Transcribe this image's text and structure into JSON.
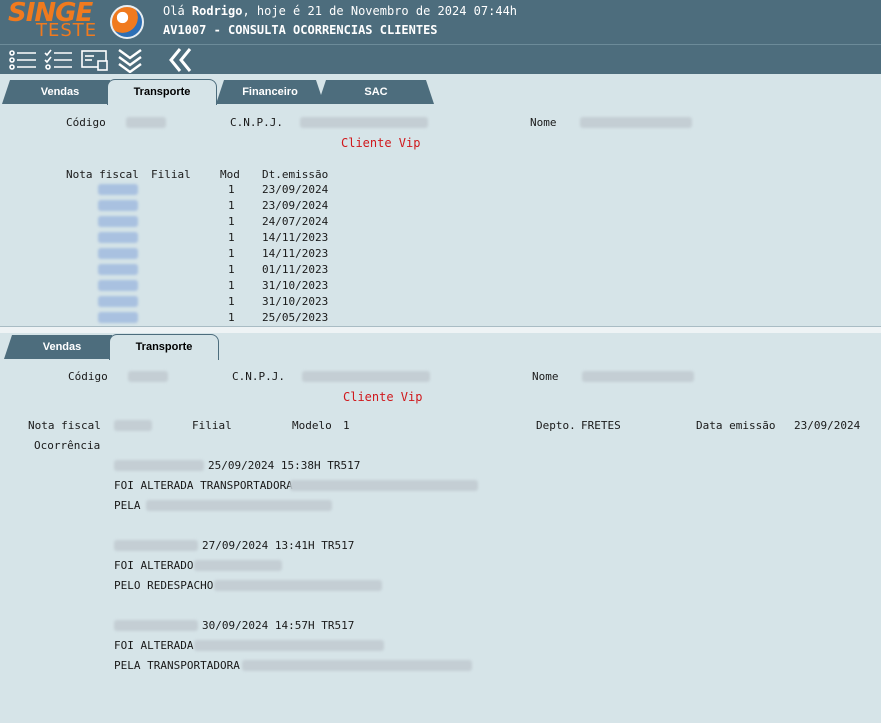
{
  "header": {
    "logo_top": "SINGE",
    "logo_bottom": "TESTE",
    "greeting_prefix": "Olá ",
    "user_name": "Rodrigo",
    "greeting_suffix": ", hoje é 21 de Novembro de 2024 07:44h",
    "screen_title": "AV1007 - CONSULTA OCORRENCIAS CLIENTES"
  },
  "toolbar": {
    "icons": [
      "list-icon",
      "checklist-icon",
      "card-icon",
      "double-chevron-down-icon",
      "double-chevron-left-icon"
    ]
  },
  "top_tabs": [
    "Vendas",
    "Transporte",
    "Financeiro",
    "SAC"
  ],
  "top_panel": {
    "codigo_label": "Código",
    "cnpj_label": "C.N.P.J.",
    "nome_label": "Nome",
    "vip_text": "Cliente Vip",
    "columns": [
      "Nota fiscal",
      "Filial",
      "Mod",
      "Dt.emissão"
    ],
    "rows": [
      {
        "mod": "1",
        "date": "23/09/2024"
      },
      {
        "mod": "1",
        "date": "23/09/2024"
      },
      {
        "mod": "1",
        "date": "24/07/2024"
      },
      {
        "mod": "1",
        "date": "14/11/2023"
      },
      {
        "mod": "1",
        "date": "14/11/2023"
      },
      {
        "mod": "1",
        "date": "01/11/2023"
      },
      {
        "mod": "1",
        "date": "31/10/2023"
      },
      {
        "mod": "1",
        "date": "31/10/2023"
      },
      {
        "mod": "1",
        "date": "25/05/2023"
      }
    ]
  },
  "bottom_tabs": [
    "Vendas",
    "Transporte"
  ],
  "bottom_panel": {
    "codigo_label": "Código",
    "cnpj_label": "C.N.P.J.",
    "nome_label": "Nome",
    "vip_text": "Cliente Vip",
    "nota_label": "Nota fiscal",
    "filial_label": "Filial",
    "modelo_label": "Modelo",
    "modelo_value": "1",
    "depto_label": "Depto.",
    "depto_value": "FRETES",
    "data_label": "Data emissão",
    "data_value": "23/09/2024",
    "ocorrencia_label": "Ocorrência",
    "entries": [
      {
        "stamp": "25/09/2024 15:38H TR517",
        "line1": "FOI ALTERADA TRANSPORTADORA",
        "line2": "PELA"
      },
      {
        "stamp": "27/09/2024 13:41H TR517",
        "line1": "FOI ALTERADO",
        "line2": "PELO REDESPACHO"
      },
      {
        "stamp": "30/09/2024 14:57H TR517",
        "line1": "FOI ALTERADA",
        "line2": "PELA TRANSPORTADORA"
      }
    ]
  }
}
